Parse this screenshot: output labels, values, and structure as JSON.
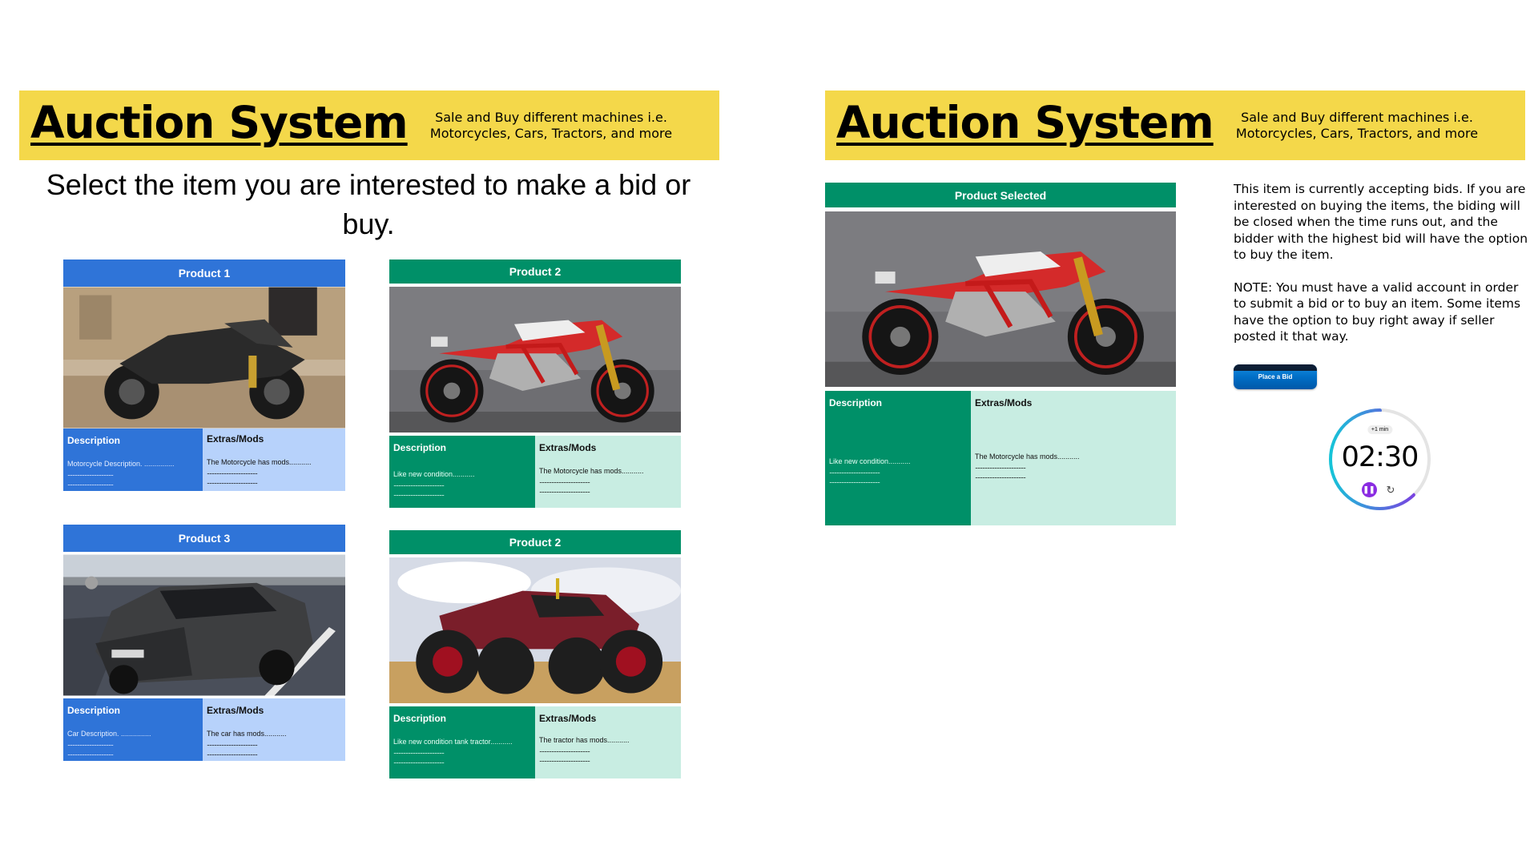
{
  "left_panel": {
    "title": "Auction System",
    "tagline_line1": "Sale and Buy different machines i.e.",
    "tagline_line2": "Motorcycles, Cars, Tractors, and more",
    "instruction": "Select the item you are interested to make a bid or buy.",
    "products": [
      {
        "header": "Product 1",
        "desc_label": "Description",
        "desc_text": "Motorcycle Description. ...............",
        "desc_dots1": "......................................",
        "desc_dots2": "......................................",
        "extras_label": "Extras/Mods",
        "extras_text": "The Motorcycle has mods...........",
        "extras_dots1": "..........................................",
        "extras_dots2": ".........................................."
      },
      {
        "header": "Product 2",
        "desc_label": "Description",
        "desc_text": "Like new condition...........",
        "desc_dots1": "..........................................",
        "desc_dots2": "..........................................",
        "extras_label": "Extras/Mods",
        "extras_text": "The Motorcycle has mods...........",
        "extras_dots1": "..........................................",
        "extras_dots2": ".........................................."
      },
      {
        "header": "Product 3",
        "desc_label": "Description",
        "desc_text": "Car Description. ...............",
        "desc_dots1": "......................................",
        "desc_dots2": "......................................",
        "extras_label": "Extras/Mods",
        "extras_text": "The car has mods...........",
        "extras_dots1": "..........................................",
        "extras_dots2": ".........................................."
      },
      {
        "header": "Product 2",
        "desc_label": "Description",
        "desc_text": "Like new condition tank tractor...........",
        "desc_dots1": "..........................................",
        "desc_dots2": "..........................................",
        "extras_label": "Extras/Mods",
        "extras_text": "The tractor has mods...........",
        "extras_dots1": "..........................................",
        "extras_dots2": ".........................................."
      }
    ]
  },
  "right_panel": {
    "title": "Auction System",
    "tagline_line1": "Sale and Buy different machines i.e.",
    "tagline_line2": "Motorcycles, Cars, Tractors, and more",
    "selected": {
      "header": "Product Selected",
      "desc_label": "Description",
      "desc_text": "Like new condition...........",
      "desc_dots1": "..........................................",
      "desc_dots2": "..........................................",
      "extras_label": "Extras/Mods",
      "extras_text": "The Motorcycle has mods...........",
      "extras_dots1": "..........................................",
      "extras_dots2": ".........................................."
    },
    "notice_p1": "This item is currently accepting bids. If you are interested on buying the items, the biding will be closed when the time runs out, and the bidder with the highest bid will have the option to buy the item.",
    "notice_p2": "NOTE: You must have a valid account in order to submit a bid or to buy an item. Some items have the option to buy right away if seller posted it that way.",
    "bid_button": "Place a Bid",
    "timer": {
      "add_label": "+1 min",
      "time": "02:30",
      "pause_icon": "pause-icon",
      "reset_icon": "reset-icon",
      "progress": 0.62
    }
  },
  "colors": {
    "banner": "#f4d84a",
    "blue": "#2f74d8",
    "light_blue": "#b7d2fb",
    "green": "#009068",
    "mint": "#c8ede2",
    "timer_purple": "#8a2be2",
    "timer_cyan": "#16c4d8"
  }
}
